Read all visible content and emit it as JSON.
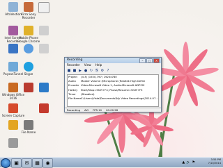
{
  "desktop_icons": [
    {
      "label": "AltaVestion",
      "color": "#8fb3d6"
    },
    {
      "label": "Kirra Sony Recorder",
      "color": "#c66a3a"
    },
    {
      "label": "Intel Screen Recorder",
      "color": "#a35a9e"
    },
    {
      "label": "Mobile Phone Google Chrome",
      "color": "#e0b12a"
    },
    {
      "label": "",
      "color": "#3a75c4"
    },
    {
      "label": "",
      "color": "#5a9de0"
    },
    {
      "label": "PaysanTunnel",
      "color": "#6fa9d8"
    },
    {
      "label": "Skype",
      "color": "#1ea0e0"
    },
    {
      "label": "Windows Office 2016",
      "color": "#c86a22"
    },
    {
      "label": "",
      "color": "#b93b2f"
    },
    {
      "label": "Screen Capture",
      "color": "#d64b2c"
    },
    {
      "label": "",
      "color": "#2d7bc8"
    },
    {
      "label": "File Name",
      "color": "#e3a521"
    },
    {
      "label": "",
      "color": "#c43a2d"
    },
    {
      "label": "",
      "color": "#7a7a7a"
    }
  ],
  "window": {
    "title": "Recording",
    "menu": [
      "Recorder",
      "View",
      "Help"
    ],
    "toolbar": [
      "■",
      "■",
      "▶",
      "●",
      "↻",
      "⎘",
      "⚙",
      "?"
    ],
    "info_rows": [
      {
        "key": "Project",
        "value": "(4:3) (1920,797) 1920x780"
      },
      {
        "key": "Audio",
        "value": "Master Volume (Microphone (Realtek High Defini"
      },
      {
        "key": "Encoder",
        "value": "Video:Microsoft Video 1, Audio:Microsoft ADPCM"
      },
      {
        "key": "Hotkey",
        "value": "Start/Stop=Shift+F4; Pause/Resume=Shift+F5"
      },
      {
        "key": "Timer",
        "value": "(Disabled)"
      },
      {
        "key": "File Name",
        "value": "C:\\Users\\Vista\\Documents\\My Video Recordings\\2014-07..."
      }
    ],
    "status": [
      "Recording",
      "AVI",
      "FPS:10",
      "00:00:28"
    ]
  },
  "taskbar": {
    "buttons": [
      "▣",
      "✉",
      "▦",
      "◉"
    ],
    "tray_icons": [
      "▲",
      "🔊",
      "⚑"
    ],
    "time": "3:55 PM",
    "date": "7/10/2014"
  }
}
